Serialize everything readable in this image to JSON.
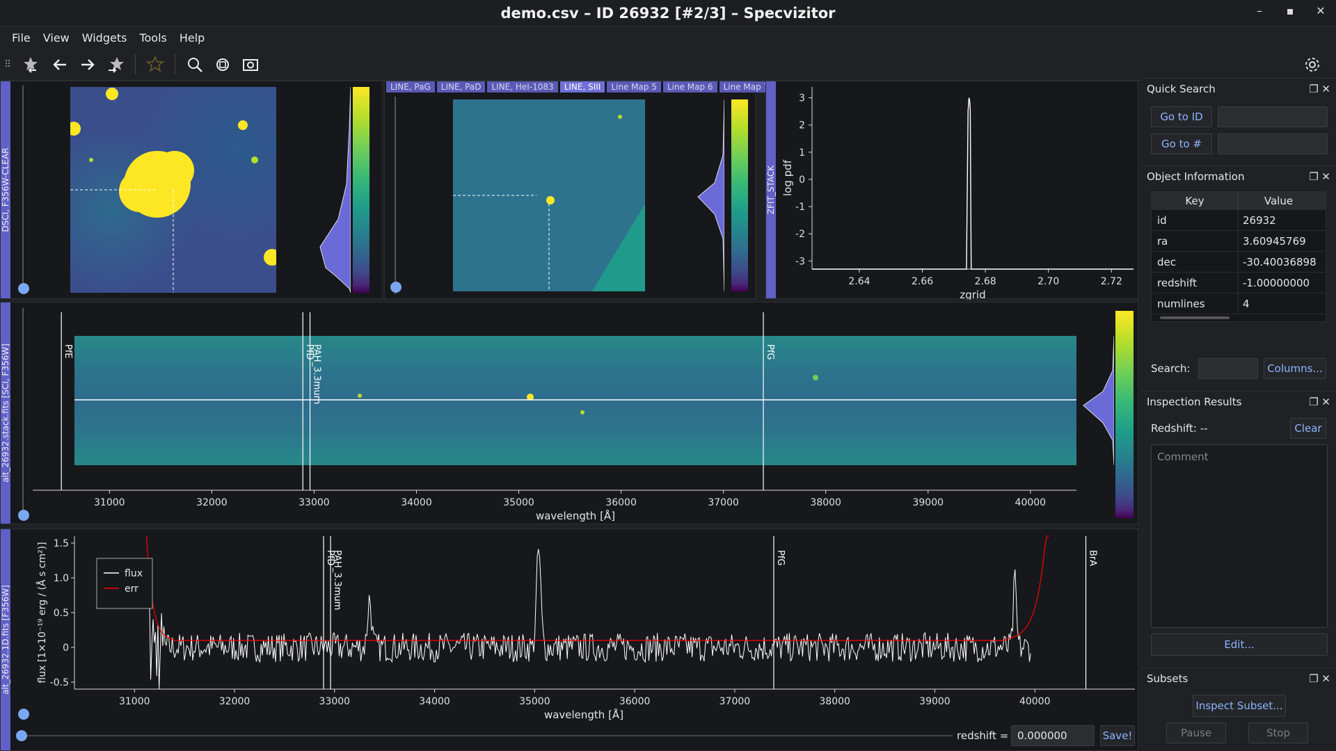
{
  "window": {
    "title": "demo.csv – ID 26932 [#2/3] – Specvizitor",
    "controls": [
      "–",
      "▪",
      "✕"
    ]
  },
  "menu": [
    "File",
    "View",
    "Widgets",
    "Tools",
    "Help"
  ],
  "toolbar": {
    "icons": [
      "star-back-icon",
      "arrow-left-icon",
      "arrow-right-icon",
      "star-forward-icon",
      "star-icon",
      "search-icon",
      "zoom-reset-icon",
      "screenshot-icon"
    ],
    "settings_icon": "gear-icon"
  },
  "image1": {
    "label": "DSCI, F356W-CLEAR"
  },
  "image2": {
    "tabs": [
      "LINE, PaG",
      "LINE, PaD",
      "LINE, HeI-1083",
      "LINE, SIII",
      "Line Map 5",
      "Line Map 6",
      "Line Map 7"
    ],
    "active_tab": 3
  },
  "zfit": {
    "label": "ZFIT_STACK",
    "xlabel": "zgrid",
    "ylabel": "log pdf"
  },
  "chart_data": [
    {
      "type": "line",
      "title": "",
      "xlabel": "zgrid",
      "ylabel": "log pdf",
      "xlim": [
        2.625,
        2.727
      ],
      "ylim": [
        -3.3,
        3.4
      ],
      "xticks": [
        "2.64",
        "2.66",
        "2.68",
        "2.70",
        "2.72"
      ],
      "yticks": [
        "3",
        "2",
        "1",
        "0",
        "-1",
        "-2",
        "-3"
      ],
      "x": [
        2.625,
        2.674,
        2.6745,
        2.6748,
        2.675,
        2.6752,
        2.6755,
        2.727
      ],
      "y": [
        -3.3,
        -3.3,
        2.5,
        3.0,
        2.9,
        2.6,
        -3.3,
        -3.3
      ]
    }
  ],
  "spec2d": {
    "label": "alt_26932.stack.fits [SCI, F356W]",
    "xlabel": "wavelength [Å]",
    "xticks": [
      "31000",
      "32000",
      "33000",
      "34000",
      "35000",
      "36000",
      "37000",
      "38000",
      "39000",
      "40000"
    ],
    "lines": [
      "PfE",
      "PfD",
      "PAH_3.3mum",
      "PfG"
    ]
  },
  "spec1d": {
    "label": "alt_26932.1D.fits [F356W]",
    "xlabel": "wavelength [Å]",
    "ylabel": "flux [1×10⁻¹⁹ erg / (Å s cm²)]",
    "xticks": [
      "31000",
      "32000",
      "33000",
      "34000",
      "35000",
      "36000",
      "37000",
      "38000",
      "39000",
      "40000"
    ],
    "yticks": [
      "1.5",
      "1.0",
      "0.5",
      "0",
      "-0.5"
    ],
    "legend": [
      {
        "name": "flux",
        "color": "#ffffff"
      },
      {
        "name": "err",
        "color": "#ff0000"
      }
    ],
    "lines": [
      "PfD",
      "PAH_3.3mum",
      "PfG",
      "BrA"
    ]
  },
  "redshift_bar": {
    "label": "redshift =",
    "value": "0.000000",
    "save": "Save!"
  },
  "quick_search": {
    "title": "Quick Search",
    "go_id": "Go to ID",
    "go_num": "Go to #"
  },
  "object_info": {
    "title": "Object Information",
    "headers": [
      "Key",
      "Value"
    ],
    "rows": [
      {
        "k": "id",
        "v": "26932"
      },
      {
        "k": "ra",
        "v": "3.60945769"
      },
      {
        "k": "dec",
        "v": "-30.40036898"
      },
      {
        "k": "redshift",
        "v": "-1.00000000"
      },
      {
        "k": "numlines",
        "v": "4"
      }
    ],
    "search_label": "Search:",
    "columns_btn": "Columns..."
  },
  "inspection": {
    "title": "Inspection Results",
    "redshift_text": "Redshift: --",
    "clear": "Clear",
    "comment_placeholder": "Comment",
    "edit": "Edit..."
  },
  "subsets": {
    "title": "Subsets",
    "inspect": "Inspect Subset...",
    "pause": "Pause",
    "stop": "Stop"
  },
  "colors": {
    "accent": "#6060c8",
    "link": "#8fb5ff",
    "flux": "#ffffff",
    "err": "#ff0000"
  }
}
